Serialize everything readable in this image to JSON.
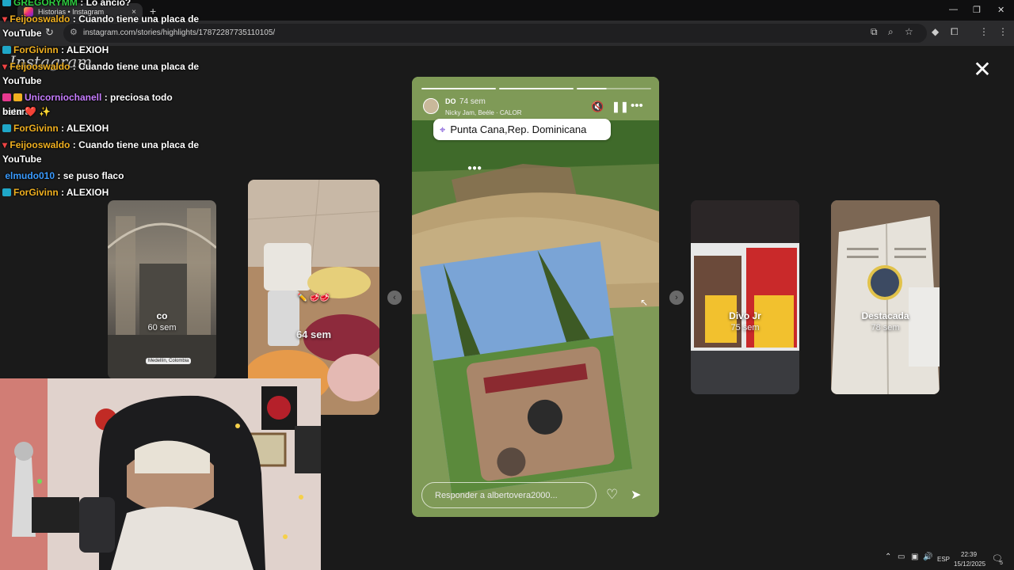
{
  "browser": {
    "tab_title": "Historias • Instagram",
    "tab_close": "×",
    "new_tab": "+",
    "url": "instagram.com/stories/highlights/17872287735110105/",
    "minimize": "—",
    "restore": "❐",
    "close": "✕"
  },
  "instagram": {
    "logo": "Instagram",
    "close_glyph": "✕"
  },
  "side_stories": [
    {
      "name": "co",
      "time": "60 sem",
      "location": "Medellín, Colombia"
    },
    {
      "name": "",
      "time": "64 sem",
      "sticker": "✏️ 🥩🥩"
    },
    {
      "name": "Divo Jr",
      "time": "75 sem"
    },
    {
      "name": "Destacada",
      "time": "78 sem"
    }
  ],
  "story": {
    "username": "DO",
    "time": "74 sem",
    "music": "Nicky Jam, Beéle · CALOR",
    "location": "Punta Cana,Rep. Dominicana",
    "reply_placeholder": "Responder a albertovera2000...",
    "progress": [
      1,
      1,
      0.4
    ],
    "icons": {
      "mute": "mute-icon",
      "pause": "pause-icon",
      "more": "more-icon",
      "heart": "heart-icon",
      "share": "share-icon"
    }
  },
  "nav": {
    "prev": "‹",
    "next": "›"
  },
  "chat": [
    {
      "user": "GREGORYMM",
      "text": "Lo ancio?",
      "color": "#2ecc40"
    },
    {
      "user": "Feijooswaldo",
      "text": "Cuando tiene una placa de",
      "color": "#f0b020"
    },
    {
      "user": "",
      "text": "YouTube",
      "color": "#ffffff"
    },
    {
      "user": "ForGivinn",
      "text": "ALEXIOH",
      "color": "#f0b020"
    },
    {
      "user": "Feijooswaldo",
      "text": "Cuando tiene una placa de",
      "color": "#f0b020"
    },
    {
      "user": "",
      "text": "YouTube",
      "color": "#ffffff"
    },
    {
      "user": "Unicorniochanell",
      "text": "preciosa todo estará",
      "color": "#c77dff"
    },
    {
      "user": "",
      "text": "bien ❤️ ✨",
      "color": "#ffffff"
    },
    {
      "user": "ForGivinn",
      "text": "ALEXIOH",
      "color": "#f0b020"
    },
    {
      "user": "Feijooswaldo",
      "text": "Cuando tiene una placa de",
      "color": "#f0b020"
    },
    {
      "user": "",
      "text": "YouTube",
      "color": "#ffffff"
    },
    {
      "user": "elmudo010",
      "text": "se puso flaco",
      "color": "#3a9bff"
    },
    {
      "user": "ForGivinn",
      "text": "ALEXIOH",
      "color": "#f0b020"
    }
  ],
  "taskbar": {
    "lang": "ESP",
    "time": "22:39",
    "date": "15/12/2025",
    "notif": "5"
  }
}
